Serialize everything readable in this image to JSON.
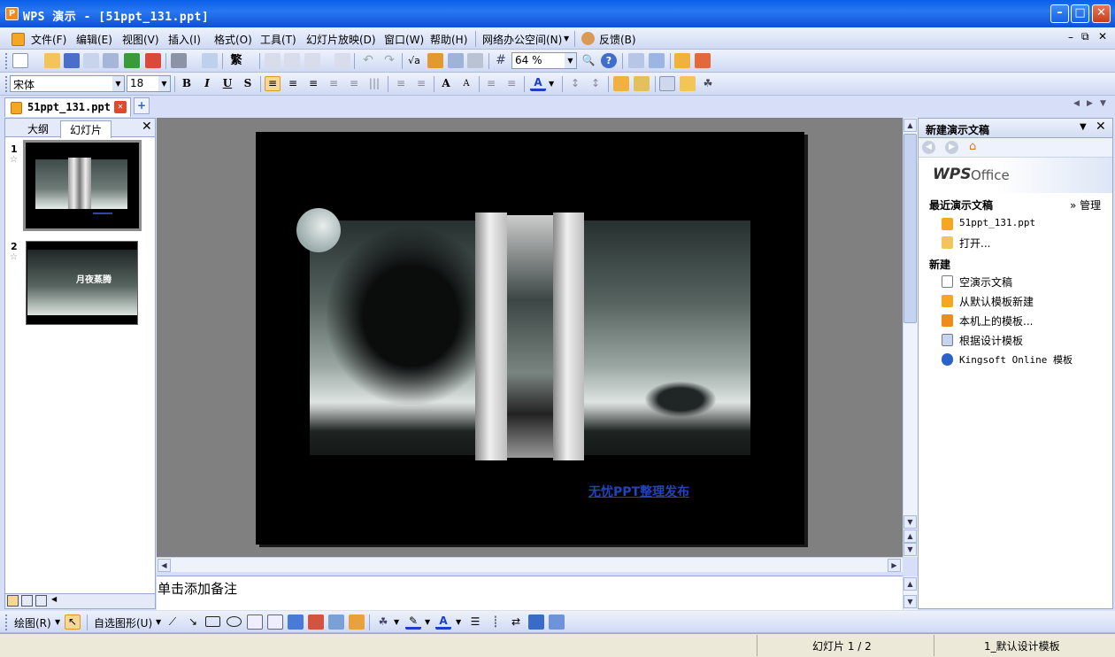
{
  "window": {
    "title": "WPS 演示 - [51ppt_131.ppt]",
    "app_icon": "P"
  },
  "menu": {
    "items": [
      "文件(F)",
      "编辑(E)",
      "视图(V)",
      "插入(I)",
      "格式(O)",
      "工具(T)",
      "幻灯片放映(D)",
      "窗口(W)",
      "帮助(H)",
      "网络办公空间(N)",
      "反馈(B)"
    ]
  },
  "toolbar": {
    "zoom_value": "64 %",
    "font_name": "宋体",
    "font_size": "18",
    "bold": "B",
    "italic": "I",
    "underline": "U",
    "shadow": "S",
    "font_color_letter": "A"
  },
  "tabs": {
    "document": "51ppt_131.ppt"
  },
  "left_panel": {
    "tab_outline": "大纲",
    "tab_slides": "幻灯片",
    "slides": [
      {
        "number": "1",
        "caption": ""
      },
      {
        "number": "2",
        "caption": "月夜蒸腾"
      }
    ]
  },
  "slide": {
    "link_text": "无忧PPT整理发布"
  },
  "notes": {
    "placeholder": "单击添加备注"
  },
  "task_pane": {
    "title": "新建演示文稿",
    "logo_wps": "WPS",
    "logo_office": "Office",
    "recent_heading": "最近演示文稿",
    "manage": "» 管理",
    "recent_items": [
      "51ppt_131.ppt",
      "打开..."
    ],
    "new_heading": "新建",
    "new_items": [
      "空演示文稿",
      "从默认模板新建",
      "本机上的模板...",
      "根据设计模板",
      "Kingsoft Online 模板"
    ]
  },
  "draw_toolbar": {
    "draw_menu": "绘图(R)",
    "autoshapes_menu": "自选图形(U)"
  },
  "status": {
    "slide_position": "幻灯片 1 / 2",
    "template": "1_默认设计模板"
  },
  "colors": {
    "title_bar": "#0b52d4",
    "link": "#2244bb"
  }
}
